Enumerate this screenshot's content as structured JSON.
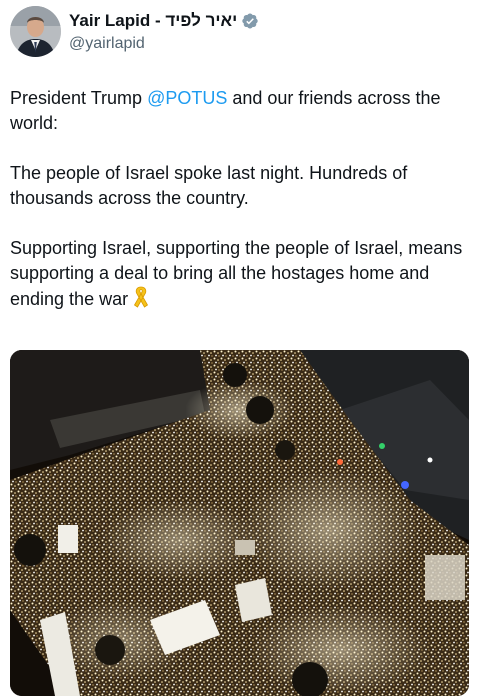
{
  "author": {
    "display_name": "Yair Lapid - יאיר לפיד",
    "handle": "@yairlapid",
    "verified_icon": "verified-badge-icon",
    "avatar_icon": "profile-photo"
  },
  "tweet": {
    "p1_a": "President Trump ",
    "p1_mention": "@POTUS",
    "p1_b": " and our friends across the world:",
    "p2": "The people of Israel spoke last night. Hundreds of thousands across the country.",
    "p3": "Supporting Israel, supporting the people of Israel, means supporting a deal to bring all the hostages home and ending the war",
    "ribbon_icon": "yellow-ribbon-icon"
  },
  "media": {
    "description_icon": "aerial-night-crowd-photo"
  },
  "colors": {
    "mention": "#1d9bf0",
    "verified": "#829aab",
    "ribbon": "#f5c21b"
  }
}
